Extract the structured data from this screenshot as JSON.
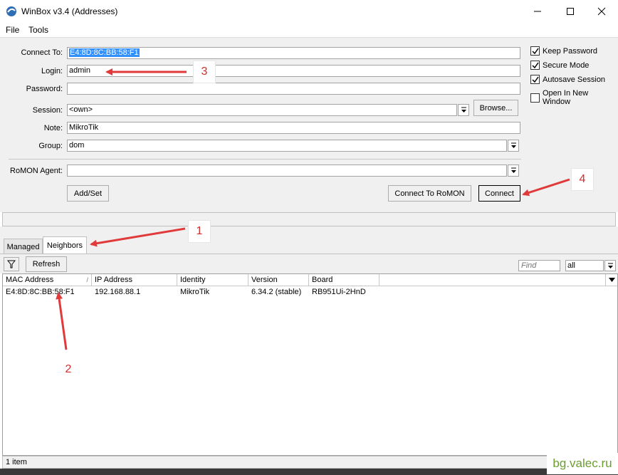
{
  "window": {
    "title": "WinBox v3.4 (Addresses)",
    "controls": [
      "minimize",
      "maximize",
      "close"
    ]
  },
  "menu": {
    "items": [
      "File",
      "Tools"
    ]
  },
  "form": {
    "connect_to": {
      "label": "Connect To:",
      "value": "E4:8D:8C:BB:58:F1"
    },
    "login": {
      "label": "Login:",
      "value": "admin"
    },
    "password": {
      "label": "Password:",
      "value": ""
    },
    "session": {
      "label": "Session:",
      "value": "<own>"
    },
    "note": {
      "label": "Note:",
      "value": "MikroTik"
    },
    "group": {
      "label": "Group:",
      "value": "dom"
    },
    "romon_agent": {
      "label": "RoMON Agent:",
      "value": ""
    },
    "browse_label": "Browse...",
    "add_set_label": "Add/Set",
    "connect_romon_label": "Connect To RoMON",
    "connect_label": "Connect"
  },
  "options": [
    {
      "label": "Keep Password",
      "checked": true
    },
    {
      "label": "Secure Mode",
      "checked": true
    },
    {
      "label": "Autosave Session",
      "checked": true
    },
    {
      "label": "Open In New Window",
      "checked": false
    }
  ],
  "tabs": [
    {
      "label": "Managed",
      "active": false
    },
    {
      "label": "Neighbors",
      "active": true
    }
  ],
  "toolbar": {
    "refresh_label": "Refresh",
    "find_placeholder": "Find",
    "filter_value": "all"
  },
  "table": {
    "columns": [
      "MAC Address",
      "IP Address",
      "Identity",
      "Version",
      "Board"
    ],
    "rows": [
      [
        "E4:8D:8C:BB:58:F1",
        "192.168.88.1",
        "MikroTik",
        "6.34.2 (stable)",
        "RB951Ui-2HnD"
      ]
    ]
  },
  "status": {
    "item_count": "1 item"
  },
  "annotations": {
    "one": "1",
    "two": "2",
    "three": "3",
    "four": "4",
    "color": "#d62b2b"
  },
  "watermark": "bg.valec.ru",
  "colors": {
    "selection": "#3390ff",
    "panel": "#f0f0f0",
    "arrow": "#e03a3a",
    "watermark": "#6b9e2f"
  }
}
